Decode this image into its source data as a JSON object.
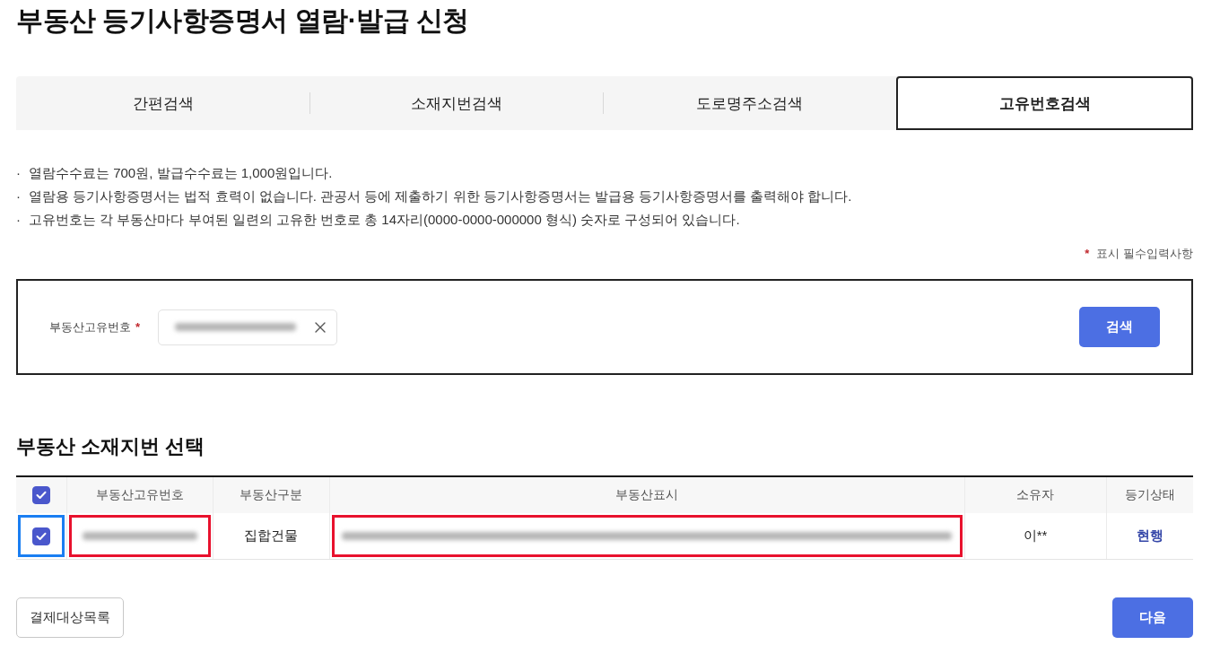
{
  "page": {
    "title": "부동산 등기사항증명서 열람·발급 신청"
  },
  "tabs": [
    {
      "label": "간편검색",
      "selected": false
    },
    {
      "label": "소재지번검색",
      "selected": false
    },
    {
      "label": "도로명주소검색",
      "selected": false
    },
    {
      "label": "고유번호검색",
      "selected": true
    }
  ],
  "notes": [
    {
      "bullet": "·",
      "text": "열람수수료는 700원, 발급수수료는 1,000원입니다."
    },
    {
      "bullet": "·",
      "text": "열람용 등기사항증명서는 법적 효력이 없습니다. 관공서 등에 제출하기 위한 등기사항증명서는 발급용 등기사항증명서를 출력해야 합니다."
    },
    {
      "bullet": "·",
      "text": "고유번호는 각 부동산마다 부여된 일련의 고유한 번호로 총 14자리(0000-0000-000000 형식) 숫자로 구성되어 있습니다."
    }
  ],
  "required_legend": {
    "mark": "*",
    "text": "표시 필수입력사항"
  },
  "search_form": {
    "label": "부동산고유번호",
    "required_mark": "*",
    "value_redacted": true,
    "button": "검색"
  },
  "section_title": "부동산 소재지번 선택",
  "table": {
    "select_all_checked": true,
    "columns": [
      "부동산고유번호",
      "부동산구분",
      "부동산표시",
      "소유자",
      "등기상태"
    ],
    "rows": [
      {
        "checked": true,
        "checkbox_highlight": {
          "color": "#1a7ef2"
        },
        "cells": [
          {
            "kind": "redacted",
            "highlight": {
              "color": "#e8112d"
            }
          },
          {
            "kind": "text",
            "text": "집합건물"
          },
          {
            "kind": "redacted",
            "highlight": {
              "color": "#e8112d"
            }
          },
          {
            "kind": "text",
            "text": "이**"
          },
          {
            "kind": "link",
            "text": "현행"
          }
        ]
      }
    ]
  },
  "buttons": [
    {
      "label": "결제대상목록",
      "kind": "secondary"
    },
    {
      "label": "다음",
      "kind": "primary"
    }
  ]
}
